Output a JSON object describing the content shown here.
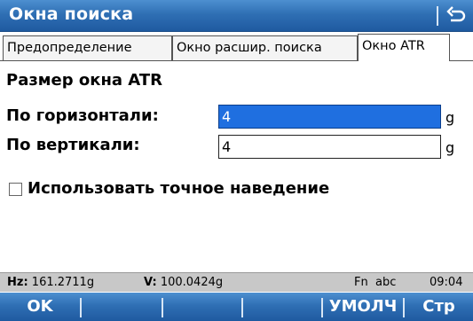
{
  "window": {
    "title": "Окна поиска",
    "back_icon": "return-arrow-icon"
  },
  "tabs": [
    {
      "label": "Предопределение",
      "active": false
    },
    {
      "label": "Окно расшир. поиска",
      "active": false
    },
    {
      "label": "Окно ATR",
      "active": true
    }
  ],
  "section": {
    "title": "Размер окна ATR"
  },
  "fields": {
    "horizontal": {
      "label": "По горизонтали:",
      "value": "4",
      "unit": "g",
      "selected": true
    },
    "vertical": {
      "label": "По вертикали:",
      "value": "4",
      "unit": "g",
      "selected": false
    }
  },
  "checkbox": {
    "label": "Использовать точное наведение",
    "checked": false
  },
  "status": {
    "hz_label": "Hz:",
    "hz_value": "161.2711g",
    "v_label": "V:",
    "v_value": "100.0424g",
    "fn": "Fn  abc",
    "time": "09:04"
  },
  "softkeys": [
    "OK",
    "",
    "",
    "",
    "УМОЛЧ",
    "Стр"
  ],
  "colors": {
    "bar_blue": "#2f6fb4",
    "selection_blue": "#1f6fe0",
    "status_gray": "#c8c8c8"
  }
}
